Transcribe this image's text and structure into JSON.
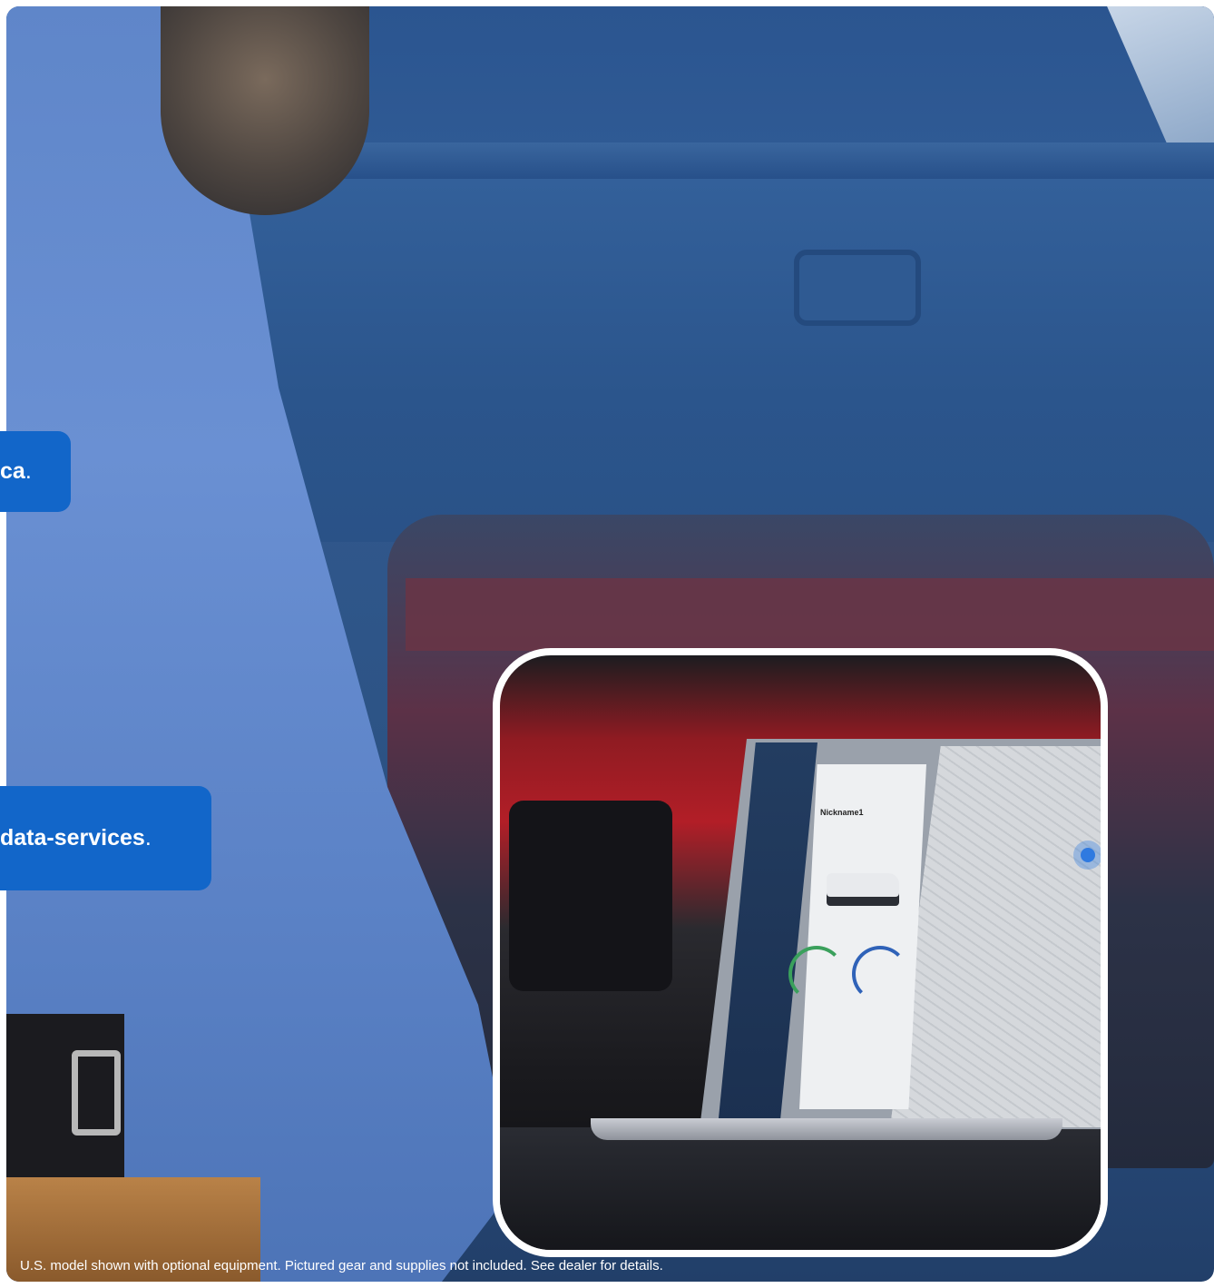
{
  "callouts": [
    {
      "text": "ca",
      "suffix": "."
    },
    {
      "text": "data-services",
      "suffix": "."
    }
  ],
  "laptop": {
    "screen_title": "Nickname1"
  },
  "disclaimer": "U.S. model shown with optional equipment. Pictured gear and supplies not included. See dealer for details.",
  "colors": {
    "callout_bg": "#1266c9",
    "inset_border": "#ffffff"
  }
}
